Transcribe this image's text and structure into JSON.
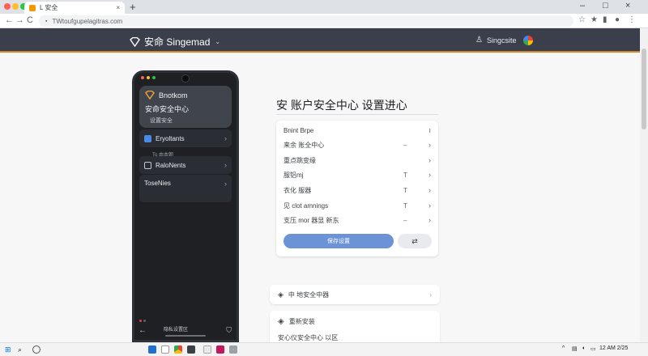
{
  "browser": {
    "tab_title": "L 安全",
    "tab_close": "×",
    "new_tab": "+",
    "window_controls": [
      "–",
      "□",
      "×"
    ],
    "nav": {
      "back": "←",
      "forward": "→",
      "reload": "C"
    },
    "url": "TWtoufgupelagitras.com",
    "toolbar": [
      "☆",
      "★",
      "▮",
      "●",
      "⋮"
    ]
  },
  "site_header": {
    "brand": "安命 Singemad",
    "brand_chevron": "⌄",
    "user_label": "Singcsite",
    "colors": {
      "bar": "#3a3f4b",
      "accent": "#d08a2c"
    }
  },
  "phone": {
    "card": {
      "title": "Bnotkom",
      "subtitle": "安命安全中心",
      "caption": "设置安全"
    },
    "items": [
      {
        "label": "Eryoltants",
        "chevron": "›"
      },
      {
        "label": "RaloNents",
        "chevron": "›"
      },
      {
        "label": "ToseNies",
        "chevron": "›"
      }
    ],
    "sub_label": "To 由本朝",
    "bottom_label": "隐私设置区"
  },
  "panel": {
    "title": "安 账户安全中心 设置进心",
    "rows": [
      {
        "label": "Bnint Brpe",
        "mid": "",
        "end": "ı"
      },
      {
        "label": "来余 账全中心",
        "mid": "–",
        "end": "›"
      },
      {
        "label": "重点跳变缘",
        "mid": "",
        "end": "›"
      },
      {
        "label": "服铝mj",
        "mid": "T",
        "end": "›"
      },
      {
        "label": "衣化 服器",
        "mid": "T",
        "end": "›"
      },
      {
        "label": "见 clot amnings",
        "mid": "T",
        "end": "›"
      },
      {
        "label": "支压 mor 器显 新东",
        "mid": "–",
        "end": "›"
      }
    ],
    "primary_button": "保存设置",
    "secondary_button": "⇄"
  },
  "sections": [
    {
      "label": "中 地安全中器",
      "chevron": "›"
    },
    {
      "label": "重新安装",
      "sub": "安心仪安全中心 以区"
    }
  ],
  "taskbar": {
    "start": "⊞",
    "search": "⌕",
    "clock": "12 AM 2/25"
  }
}
